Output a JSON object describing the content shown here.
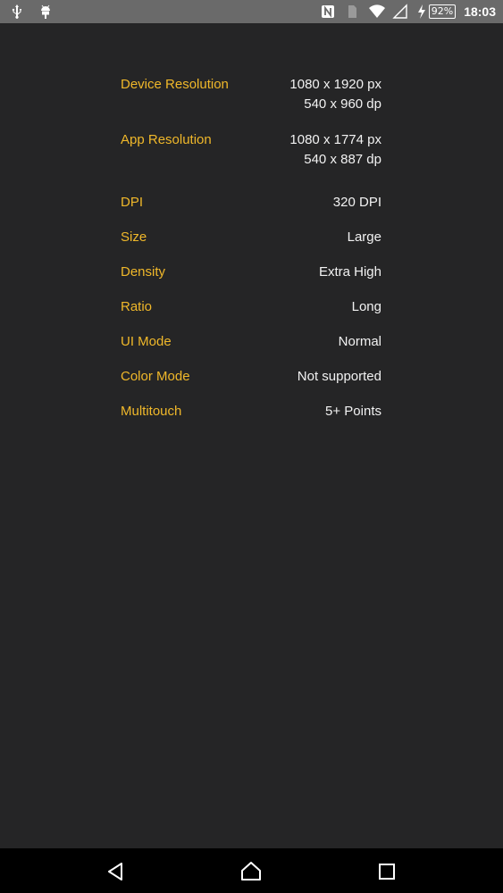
{
  "status_bar": {
    "left_icons": [
      "usb-icon",
      "android-debug-icon"
    ],
    "right_icons": [
      "nfc-icon",
      "sim-icon",
      "wifi-icon",
      "signal-icon",
      "charging-icon"
    ],
    "battery": "92%",
    "time": "18:03"
  },
  "info": {
    "rows": [
      {
        "label": "Device Resolution",
        "values": [
          "1080 x 1920 px",
          "540 x 960 dp"
        ]
      },
      {
        "label": "App Resolution",
        "values": [
          "1080 x 1774 px",
          "540 x 887 dp"
        ]
      },
      {
        "label": "DPI",
        "values": [
          "320 DPI"
        ]
      },
      {
        "label": "Size",
        "values": [
          "Large"
        ]
      },
      {
        "label": "Density",
        "values": [
          "Extra High"
        ]
      },
      {
        "label": "Ratio",
        "values": [
          "Long"
        ]
      },
      {
        "label": "UI Mode",
        "values": [
          "Normal"
        ]
      },
      {
        "label": "Color Mode",
        "values": [
          "Not supported"
        ]
      },
      {
        "label": "Multitouch",
        "values": [
          "5+ Points"
        ]
      }
    ]
  },
  "nav_bar": {
    "buttons": [
      "back-icon",
      "home-icon",
      "recents-icon"
    ]
  },
  "colors": {
    "label": "#f0b82a",
    "value": "#f2f2f2",
    "background": "#252526"
  }
}
